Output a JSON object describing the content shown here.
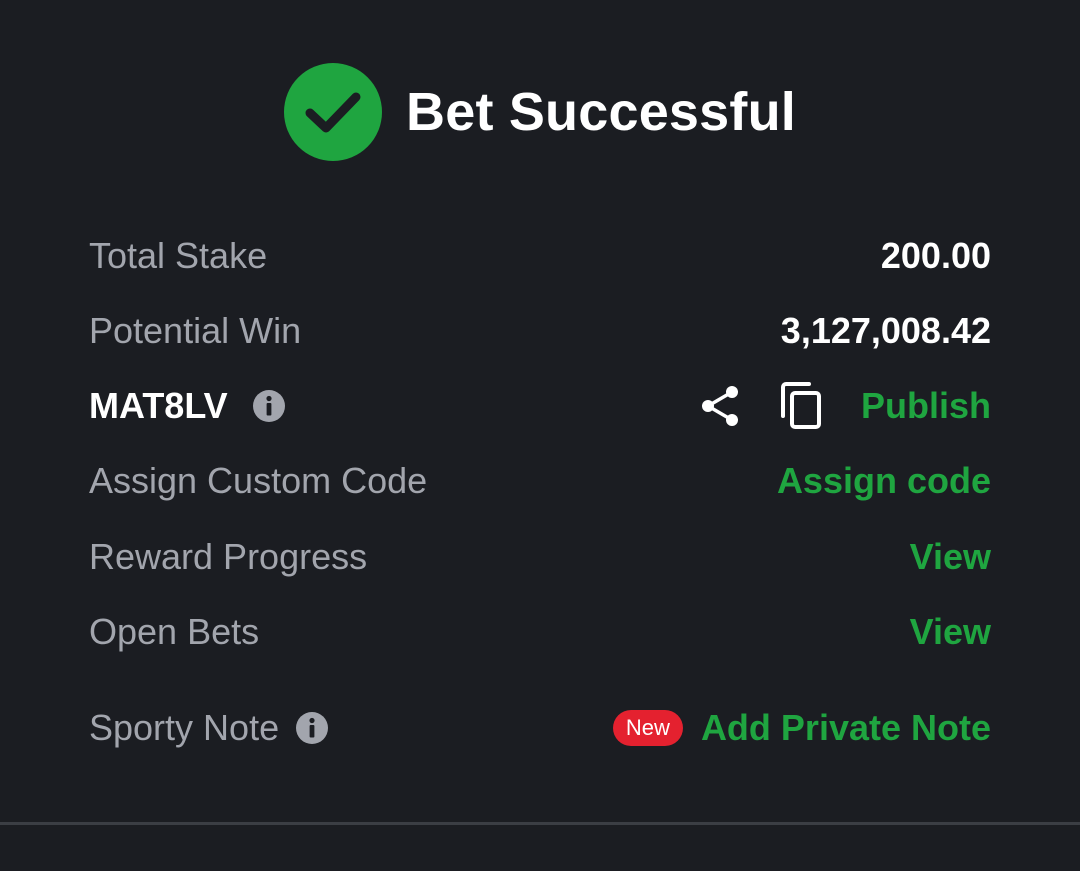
{
  "header": {
    "title": "Bet Successful",
    "icon": "check-circle-icon",
    "icon_color": "#1fa540"
  },
  "summary": {
    "total_stake_label": "Total Stake",
    "total_stake_value": "200.00",
    "potential_win_label": "Potential Win",
    "potential_win_value": "3,127,008.42"
  },
  "booking": {
    "code": "MAT8LV",
    "info_icon": "info-icon",
    "share_icon": "share-icon",
    "copy_icon": "copy-icon",
    "publish_label": "Publish"
  },
  "actions": {
    "assign_custom_code_label": "Assign Custom Code",
    "assign_code_link": "Assign code",
    "reward_progress_label": "Reward Progress",
    "reward_progress_link": "View",
    "open_bets_label": "Open Bets",
    "open_bets_link": "View"
  },
  "note": {
    "label": "Sporty Note",
    "info_icon": "info-icon",
    "badge": "New",
    "add_link": "Add Private Note"
  },
  "colors": {
    "background": "#1b1d22",
    "accent_green": "#1fa540",
    "badge_red": "#e4212f",
    "muted_text": "#a2a5ad"
  }
}
